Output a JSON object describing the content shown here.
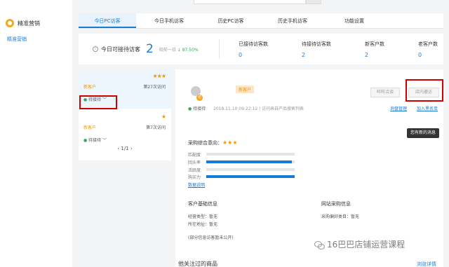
{
  "sidebar": {
    "logo_text": "精准营销",
    "nav_item": "精准营销"
  },
  "tabs": [
    "今日PC访客",
    "今日手机访客",
    "历史PC访客",
    "历史手机访客",
    "功能设置"
  ],
  "stats": {
    "left_label": "今日可接待访客",
    "left_value": "2",
    "left_compare_prefix": "较前一日",
    "left_compare_pct": "87.50%",
    "kpis": [
      {
        "label": "已接待访客数",
        "value": "0"
      },
      {
        "label": "待接待访客数",
        "value": "2"
      },
      {
        "label": "新客户数",
        "value": "2"
      },
      {
        "label": "老客户数",
        "value": "0"
      }
    ]
  },
  "visitors": [
    {
      "stars": "★★★",
      "tag": "新客户",
      "visits": "第27次访问",
      "status": "待接待"
    },
    {
      "stars": "★",
      "tag": "新客户",
      "visits": "第7次访问",
      "status": "待接待"
    }
  ],
  "pager": "1/1",
  "detail": {
    "avatar_badge": "访",
    "new_badge": "新客户",
    "status": "待接待",
    "meta": "2018.11.10 09:22:12 | 访问来自产品搜索列表",
    "btn_phone": "旺旺洽谈",
    "btn_invite": "店内邀访",
    "link_manage": "询盘管理",
    "link_blacklist": "加入黑名单",
    "msg_button": "您有新的消息",
    "rating_label": "采购综合意向：",
    "rating_stars": "★★★",
    "metrics": [
      {
        "label": "匹配度",
        "fill": 0
      },
      {
        "label": "回头率",
        "fill": 0.97
      },
      {
        "label": "活跃度",
        "fill": 0
      },
      {
        "label": "购买力",
        "fill": 1.0
      }
    ],
    "data_link": "数据说明",
    "basic_title": "客户基础信息",
    "basic_type": "经营类型：暂无",
    "basic_location": "所在地址：暂无",
    "basic_note": "(部分信息访客暂未公开)",
    "purchase_title": "网站采购信息",
    "purchase_pref": "采购偏好类目：暂无",
    "bottom_title": "他关注过的商品",
    "bottom_link": "浏览详情"
  },
  "watermark": "16巴巴店铺运营课程",
  "colors": {
    "accent": "#1a7bd4",
    "star": "#f39800",
    "highlight": "#d10000",
    "ok": "#3aa55b"
  }
}
